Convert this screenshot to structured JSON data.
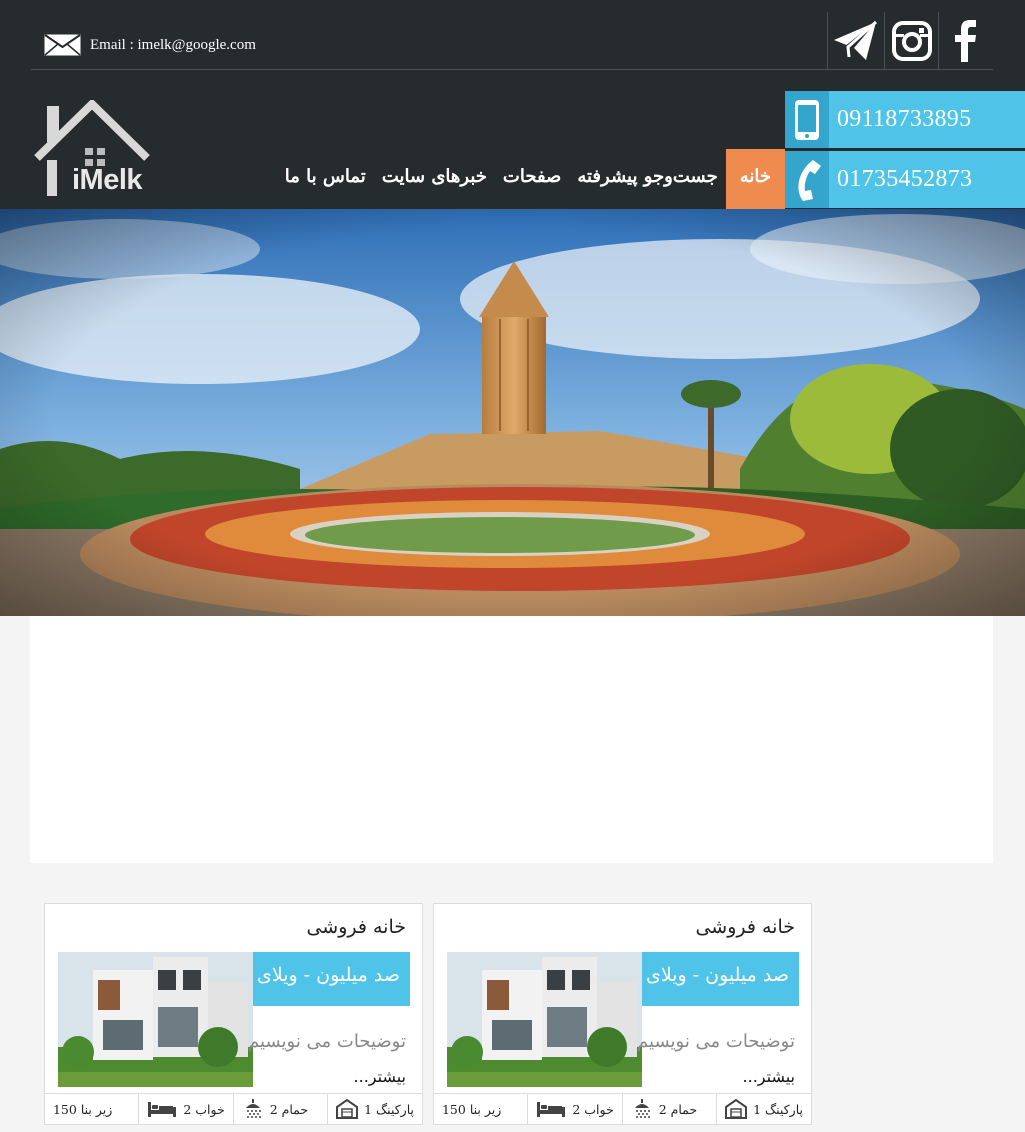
{
  "header": {
    "email_text": "Email : imelk@google.com",
    "social": [
      "telegram-icon",
      "instagram-icon",
      "facebook-icon"
    ],
    "logo_text": "iMelk",
    "phones": {
      "mobile": "09118733895",
      "tel": "01735452873"
    },
    "nav": [
      "خانه",
      "جست‌وجو پیشرفته",
      "صفحات",
      "خبرهای سایت",
      "تماس با ما"
    ]
  },
  "hero": {
    "image": "tower-landscape-photo"
  },
  "listings": [
    {
      "title": "خانه فروشی",
      "price": "صد میلیون - ویلای",
      "description": "توضیحات می نویسیم",
      "more": "بیشتر...",
      "features": {
        "parking": "پارکینگ 1",
        "bath": "حمام 2",
        "bed": "خواب 2",
        "area": "زیر بنا 150"
      }
    },
    {
      "title": "خانه فروشی",
      "price": "صد میلیون - ویلای",
      "description": "توضیحات می نویسیم",
      "more": "بیشتر...",
      "features": {
        "parking": "پارکینگ 1",
        "bath": "حمام 2",
        "bed": "خواب 2",
        "area": "زیر بنا 150"
      }
    }
  ],
  "colors": {
    "header_bg": "#262b2d",
    "accent_blue": "#4fc4e8",
    "accent_orange": "#ef8b4e"
  }
}
